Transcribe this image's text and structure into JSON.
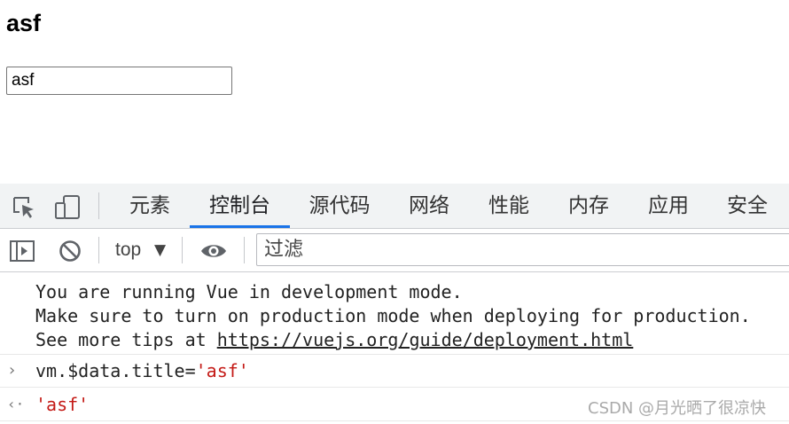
{
  "page": {
    "heading": "asf",
    "input_value": "asf"
  },
  "devtools": {
    "tabs": [
      {
        "label": "元素",
        "active": false
      },
      {
        "label": "控制台",
        "active": true
      },
      {
        "label": "源代码",
        "active": false
      },
      {
        "label": "网络",
        "active": false
      },
      {
        "label": "性能",
        "active": false
      },
      {
        "label": "内存",
        "active": false
      },
      {
        "label": "应用",
        "active": false
      },
      {
        "label": "安全",
        "active": false
      }
    ],
    "toolbar": {
      "context": "top",
      "context_arrow": "▼",
      "filter_placeholder": "过滤"
    },
    "console": {
      "vue_notice": {
        "line1": "You are running Vue in development mode.",
        "line2": "Make sure to turn on production mode when deploying for production.",
        "line3_prefix": "See more tips at ",
        "line3_link": "https://vuejs.org/guide/deployment.html"
      },
      "input": {
        "glyph": "›",
        "code_prefix": "vm.$data.title=",
        "code_string": "'asf'"
      },
      "result": {
        "glyph": "‹·",
        "value": "'asf'"
      }
    },
    "colors": {
      "active_tab_underline": "#1a73e8",
      "string_value": "#c41a16",
      "tabbar_bg": "#f1f3f4"
    }
  },
  "watermark": "CSDN @月光晒了很凉快"
}
